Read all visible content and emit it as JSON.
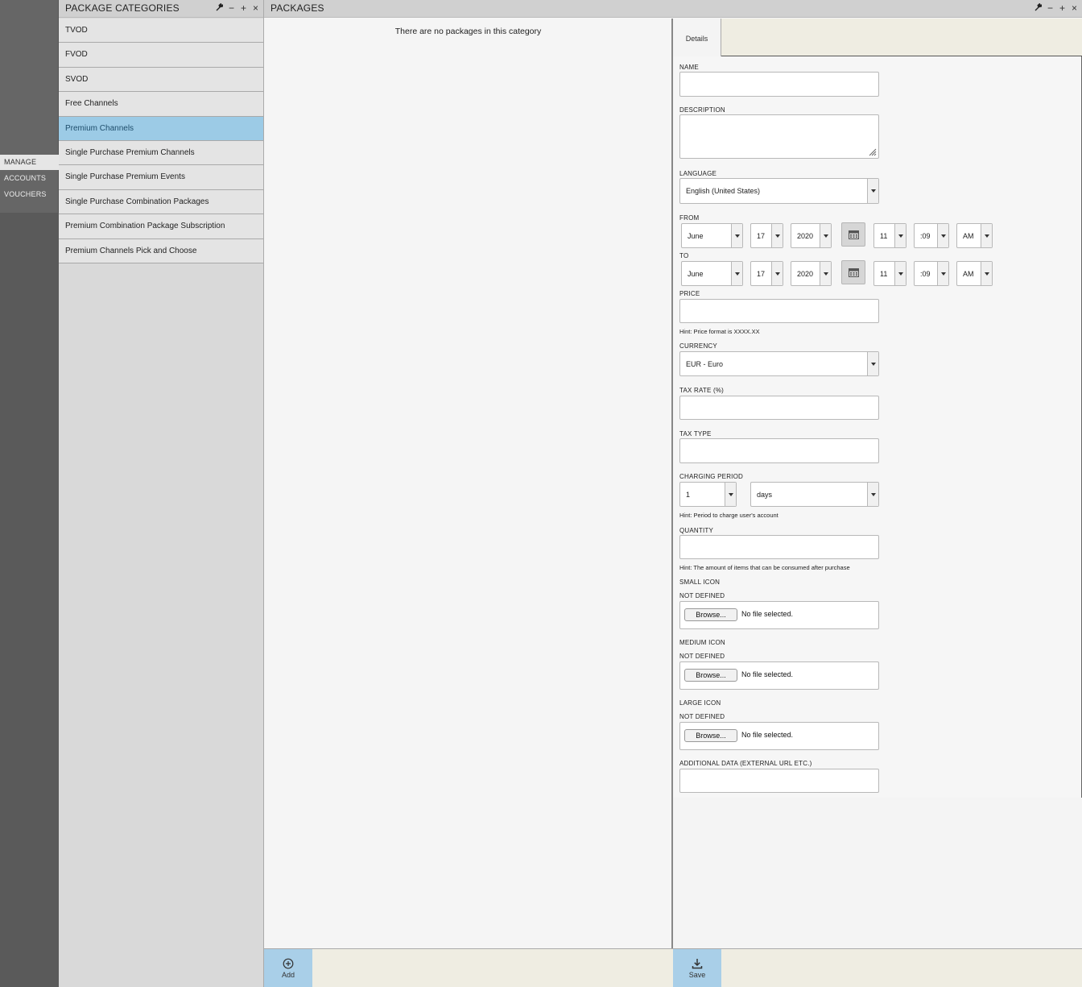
{
  "nav": {
    "items": [
      {
        "label": "MANAGE",
        "active": true
      },
      {
        "label": "ACCOUNTS",
        "active": false
      },
      {
        "label": "VOUCHERS",
        "active": false
      }
    ]
  },
  "categories": {
    "title": "PACKAGE CATEGORIES",
    "items": [
      {
        "label": "TVOD",
        "selected": false
      },
      {
        "label": "FVOD",
        "selected": false
      },
      {
        "label": "SVOD",
        "selected": false
      },
      {
        "label": "Free Channels",
        "selected": false
      },
      {
        "label": "Premium Channels",
        "selected": true
      },
      {
        "label": "Single Purchase Premium Channels",
        "selected": false
      },
      {
        "label": "Single Purchase Premium Events",
        "selected": false
      },
      {
        "label": "Single Purchase Combination Packages",
        "selected": false
      },
      {
        "label": "Premium Combination Package Subscription",
        "selected": false
      },
      {
        "label": "Premium Channels Pick and Choose",
        "selected": false
      }
    ]
  },
  "packages": {
    "title": "PACKAGES",
    "empty_message": "There are no packages in this category"
  },
  "details": {
    "tab_label": "Details",
    "name_label": "NAME",
    "name_value": "",
    "description_label": "DESCRIPTION",
    "description_value": "",
    "language_label": "LANGUAGE",
    "language_value": "English (United States)",
    "from_label": "FROM",
    "from": {
      "month": "June",
      "day": "17",
      "year": "2020",
      "hour": "11",
      "minute": ":09",
      "ampm": "AM"
    },
    "to_label": "TO",
    "to": {
      "month": "June",
      "day": "17",
      "year": "2020",
      "hour": "11",
      "minute": ":09",
      "ampm": "AM"
    },
    "price_label": "PRICE",
    "price_hint": "Hint: Price format is XXXX.XX",
    "currency_label": "CURRENCY",
    "currency_value": "EUR - Euro",
    "tax_rate_label": "TAX RATE (%)",
    "tax_type_label": "TAX TYPE",
    "charging_period_label": "CHARGING PERIOD",
    "charging_period_count": "1",
    "charging_period_unit": "days",
    "charging_period_hint": "Hint: Period to charge user's account",
    "quantity_label": "QUANTITY",
    "quantity_hint": "Hint: The amount of items that can be consumed after purchase",
    "small_icon_label": "SMALL ICON",
    "medium_icon_label": "MEDIUM ICON",
    "large_icon_label": "LARGE ICON",
    "not_defined": "NOT DEFINED",
    "browse_label": "Browse...",
    "no_file_label": "No file selected.",
    "additional_data_label": "ADDITIONAL DATA (EXTERNAL URL ETC.)"
  },
  "toolbar": {
    "add_label": "Add",
    "save_label": "Save"
  },
  "colors": {
    "selected_row": "#9ccbe6",
    "tool_button": "#a9cfe8",
    "toolbar_bg": "#efede2"
  }
}
